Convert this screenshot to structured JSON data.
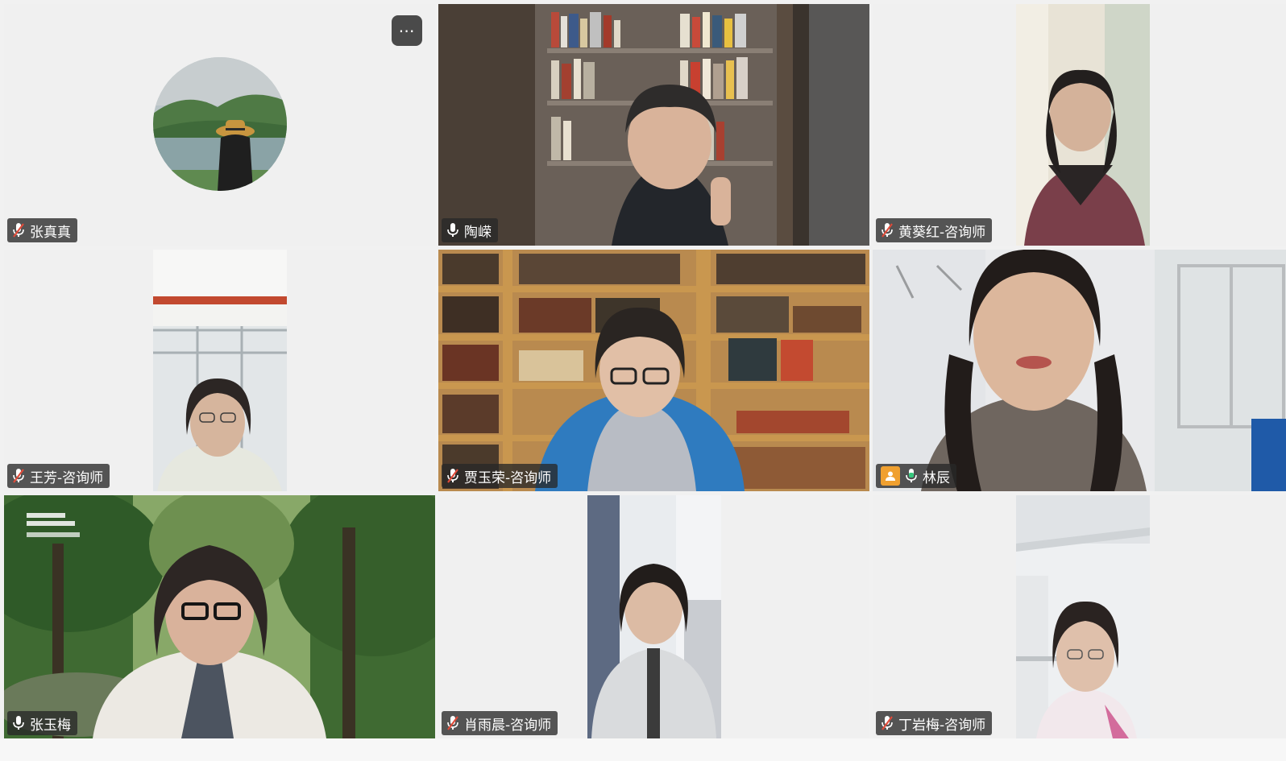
{
  "meeting": {
    "more_button_label": "⋯",
    "participants": [
      {
        "name": "张真真",
        "video": "avatar",
        "mic": "muted"
      },
      {
        "name": "陶嵘",
        "video": "bookshelf-room",
        "mic": "on"
      },
      {
        "name": "黄葵红-咨询师",
        "video": "narrow",
        "mic": "muted"
      },
      {
        "name": "王芳-咨询师",
        "video": "narrow",
        "mic": "muted"
      },
      {
        "name": "贾玉荣-咨询师",
        "video": "library",
        "mic": "muted"
      },
      {
        "name": "林辰",
        "video": "room",
        "mic": "speaking",
        "host": true,
        "active_speaker": true
      },
      {
        "name": "张玉梅",
        "video": "forest",
        "mic": "on"
      },
      {
        "name": "肖雨晨-咨询师",
        "video": "narrow",
        "mic": "muted"
      },
      {
        "name": "丁岩梅-咨询师",
        "video": "narrow",
        "mic": "muted"
      }
    ],
    "colors": {
      "active_border": "#35c77d",
      "speaking_mic": "#35c77d",
      "muted_mic": "#e04b3a",
      "host_badge": "#f0a030"
    }
  }
}
